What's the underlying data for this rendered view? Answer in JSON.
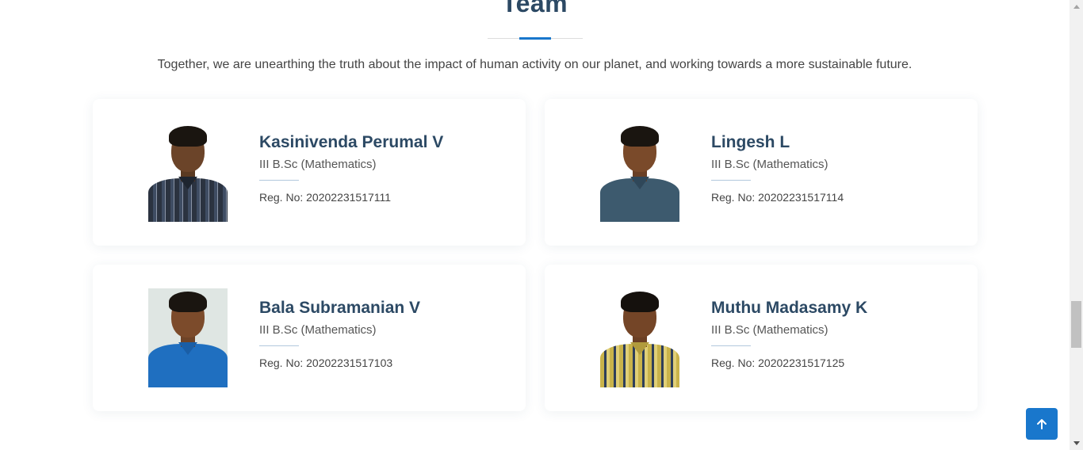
{
  "section": {
    "title": "Team",
    "intro": "Together, we are unearthing the truth about the impact of human activity on our planet, and working towards a more sustainable future."
  },
  "members": [
    {
      "name": "Kasinivenda Perumal V",
      "course": "III B.Sc (Mathematics)",
      "reg": "Reg. No: 20202231517111",
      "photo_icon": "person-photo"
    },
    {
      "name": "Lingesh L",
      "course": "III B.Sc (Mathematics)",
      "reg": "Reg. No: 20202231517114",
      "photo_icon": "person-photo"
    },
    {
      "name": "Bala Subramanian V",
      "course": "III B.Sc (Mathematics)",
      "reg": "Reg. No: 20202231517103",
      "photo_icon": "person-photo"
    },
    {
      "name": "Muthu Madasamy K",
      "course": "III B.Sc (Mathematics)",
      "reg": "Reg. No: 20202231517125",
      "photo_icon": "person-photo"
    }
  ],
  "back_to_top": {
    "icon": "arrow-up-icon"
  },
  "colors": {
    "heading": "#2c4964",
    "accent": "#1977cc",
    "text": "#444444"
  }
}
